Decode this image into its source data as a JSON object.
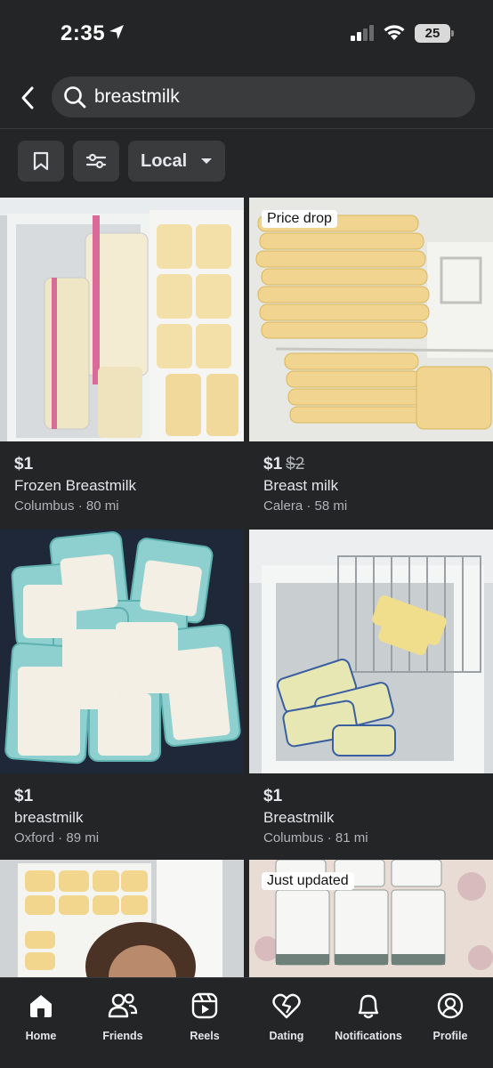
{
  "status_bar": {
    "time": "2:35",
    "battery": "25"
  },
  "search": {
    "query": "breastmilk"
  },
  "filters": {
    "location_label": "Local"
  },
  "listings": [
    {
      "price": "$1",
      "old_price": "",
      "title": "Frozen Breastmilk",
      "location": "Columbus",
      "distance": "80 mi",
      "badge": ""
    },
    {
      "price": "$1",
      "old_price": "$2",
      "title": "Breast milk",
      "location": "Calera",
      "distance": "58 mi",
      "badge": "Price drop"
    },
    {
      "price": "$1",
      "old_price": "",
      "title": "breastmilk",
      "location": "Oxford",
      "distance": "89 mi",
      "badge": ""
    },
    {
      "price": "$1",
      "old_price": "",
      "title": "Breastmilk",
      "location": "Columbus",
      "distance": "81 mi",
      "badge": ""
    },
    {
      "price": "",
      "old_price": "",
      "title": "",
      "location": "",
      "distance": "",
      "badge": ""
    },
    {
      "price": "",
      "old_price": "",
      "title": "",
      "location": "",
      "distance": "",
      "badge": "Just updated"
    }
  ],
  "nav": [
    {
      "label": "Home",
      "icon": "home-icon",
      "active": true
    },
    {
      "label": "Friends",
      "icon": "friends-icon"
    },
    {
      "label": "Reels",
      "icon": "reels-icon"
    },
    {
      "label": "Dating",
      "icon": "dating-icon"
    },
    {
      "label": "Notifications",
      "icon": "bell-icon"
    },
    {
      "label": "Profile",
      "icon": "profile-icon"
    }
  ]
}
